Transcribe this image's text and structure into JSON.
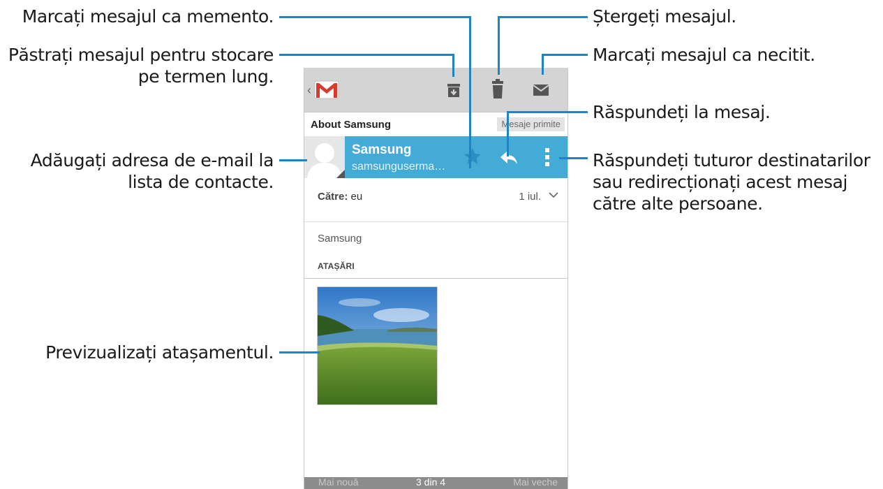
{
  "callouts": {
    "star": "Marcați mesajul ca memento.",
    "archive": "Păstrați mesajul pentru stocare pe termen lung.",
    "contact": "Adăugați adresa de e-mail la lista de contacte.",
    "preview": "Previzualizați atașamentul.",
    "delete": "Ștergeți mesajul.",
    "unread": "Marcați mesajul ca necitit.",
    "reply": "Răspundeți la mesaj.",
    "more": "Răspundeți tuturor destinatarilor sau redirecționați acest mesaj către alte persoane."
  },
  "actionbar": {
    "app_icon": "gmail-logo-icon",
    "actions": [
      "archive-icon",
      "trash-icon",
      "mark-unread-icon"
    ]
  },
  "message": {
    "subject": "About Samsung",
    "label": "Mesaje primite",
    "sender_name": "Samsung",
    "sender_email": "samsunguserma…",
    "to_label": "Către:",
    "to_value": "eu",
    "date": "1 iul.",
    "body_sender": "Samsung",
    "attachments_header": "ATAȘĂRI"
  },
  "bottombar": {
    "newer": "Mai nouă",
    "count": "3 din 4",
    "older": "Mai veche"
  },
  "colors": {
    "accent": "#44abd6",
    "callout_line": "#1f84bf",
    "actionbar": "#d4d4d4"
  }
}
